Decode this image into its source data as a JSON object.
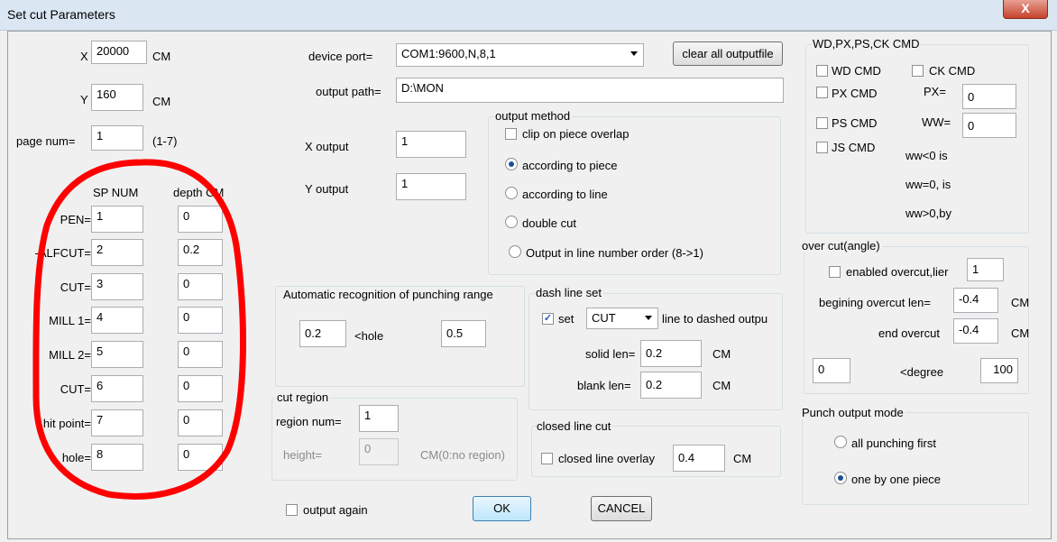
{
  "window": {
    "title": "Set cut Parameters",
    "close": "X"
  },
  "origin": {
    "x_label": "X",
    "x_value": "20000",
    "x_unit": "CM",
    "y_label": "Y",
    "y_value": "160",
    "y_unit": "CM",
    "page_label": "page num=",
    "page_value": "1",
    "page_range": "(1-7)"
  },
  "table": {
    "col_sp": "SP NUM",
    "col_depth": "depth CM",
    "rows": [
      {
        "label": "PEN=",
        "sp": "1",
        "depth": "0"
      },
      {
        "label": "-ALFCUT=",
        "sp": "2",
        "depth": "0.2"
      },
      {
        "label": "CUT=",
        "sp": "3",
        "depth": "0"
      },
      {
        "label": "MILL 1=",
        "sp": "4",
        "depth": "0"
      },
      {
        "label": "MILL 2=",
        "sp": "5",
        "depth": "0"
      },
      {
        "label": "CUT=",
        "sp": "6",
        "depth": "0"
      },
      {
        "label": "hit point=",
        "sp": "7",
        "depth": "0"
      },
      {
        "label": "hole=",
        "sp": "8",
        "depth": "0"
      }
    ]
  },
  "device": {
    "port_label": "device port=",
    "port_value": "COM1:9600,N,8,1",
    "clear_button": "clear all outputfile",
    "path_label": "output path=",
    "path_value": "D:\\MON"
  },
  "xy_output": {
    "x_label": "X output",
    "x_value": "1",
    "y_label": "Y output",
    "y_value": "1"
  },
  "output_method": {
    "title": "output method",
    "clip_label": "clip on piece overlap",
    "options": [
      "according to piece",
      "according to line",
      "double cut",
      "Output in line number order (8->1)"
    ]
  },
  "punch_range": {
    "title": "Automatic recognition of punching range",
    "min": "0.2",
    "hole_label": "<hole",
    "max": "0.5"
  },
  "dash": {
    "title": "dash line set",
    "set_label": "set",
    "type_value": "CUT",
    "suffix": "line to dashed outpu",
    "solid_label": "solid len=",
    "solid_value": "0.2",
    "solid_unit": "CM",
    "blank_label": "blank len=",
    "blank_value": "0.2",
    "blank_unit": "CM"
  },
  "cut_region": {
    "title": "cut region",
    "num_label": "region num=",
    "num_value": "1",
    "height_label": "height=",
    "height_value": "0",
    "height_hint": "CM(0:no region)"
  },
  "closed_line": {
    "title": "closed line cut",
    "overlay_label": "closed line overlay",
    "overlay_value": "0.4",
    "unit": "CM"
  },
  "commands": {
    "title": "WD,PX,PS,CK CMD",
    "wd": "WD CMD",
    "ck": "CK CMD",
    "px": "PX CMD",
    "px_eq": "PX=",
    "px_value": "0",
    "ps": "PS CMD",
    "ww_eq": "WW=",
    "ww_value": "0",
    "js": "JS CMD",
    "ww_lt": "ww<0 is",
    "ww_eq0": "ww=0, is",
    "ww_gt": "ww>0,by"
  },
  "over_cut": {
    "title": "over cut(angle)",
    "enable_label": "enabled overcut,lier",
    "enable_value": "1",
    "begin_label": "begining overcut len=",
    "begin_value": "-0.4",
    "begin_unit": "CM",
    "end_label": "end overcut",
    "end_value": "-0.4",
    "end_unit": "CM",
    "deg_min": "0",
    "deg_label": "<degree",
    "deg_max": "100"
  },
  "punch_mode": {
    "title": "Punch output mode",
    "options": [
      "all punching first",
      "one by one piece"
    ]
  },
  "footer": {
    "again_label": "output again",
    "ok": "OK",
    "cancel": "CANCEL"
  },
  "colors": {
    "annotation": "#ff0000",
    "title_bar": "#dbe6f3",
    "dialog_bg": "#f0f0f0",
    "close_button": "#c7432d"
  }
}
